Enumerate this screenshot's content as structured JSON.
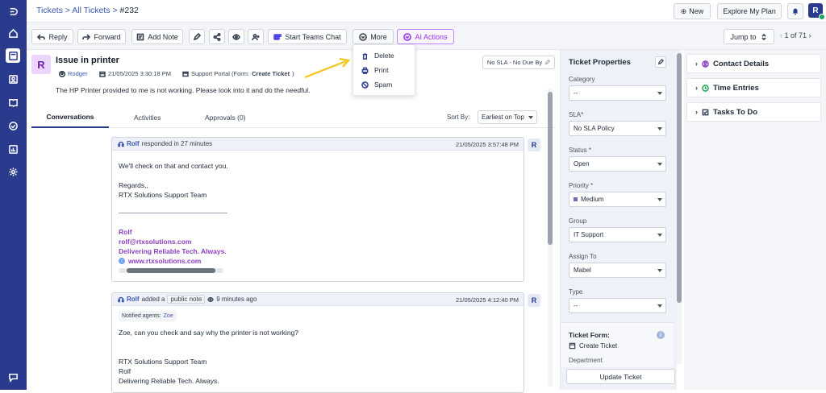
{
  "header": {
    "crumb_tickets": "Tickets",
    "sep1": ">",
    "crumb_all": "All Tickets",
    "sep2": ">",
    "ticket_no": "#232",
    "new_label": "New",
    "plan_label": "Explore My Plan",
    "avatar_initial": "R"
  },
  "toolbar": {
    "reply": "Reply",
    "forward": "Forward",
    "add_note": "Add Note",
    "teams": "Start Teams Chat",
    "more": "More",
    "ai": "AI Actions",
    "jump": "Jump to",
    "pager": "1 of 71"
  },
  "dropdown": {
    "items": [
      {
        "label": "Delete",
        "icon": "trash-icon"
      },
      {
        "label": "Print",
        "icon": "printer-icon"
      },
      {
        "label": "Spam",
        "icon": "block-icon"
      }
    ]
  },
  "ticket": {
    "initial": "R",
    "title": "Issue in printer",
    "requester": "Rodger",
    "created": "21/05/2025 3:30:18 PM",
    "source_prefix": "Support Portal (Form: ",
    "source_form": "Create Ticket",
    "source_suffix": ")",
    "description": "The HP Printer provided to me is not working. Please look into it and do the needful.",
    "sla_badge": "No SLA - No Due By"
  },
  "tabs": [
    "Conversations",
    "Activities",
    "Approvals (0)"
  ],
  "sort": {
    "label": "Sort By:",
    "value": "Earliest on Top"
  },
  "conversations": [
    {
      "author": "Rolf",
      "action": "responded in 27 minutes",
      "time": "21/05/2025 3:57:48 PM",
      "avatar": "R",
      "body": [
        "We'll check on that and contact you.",
        "Regards,,",
        "RTX Solutions Support Team"
      ],
      "signature": [
        "Rolf",
        "rolf@rtxsolutions.com",
        "Delivering Reliable Tech. Always.",
        "www.rtxsolutions.com"
      ]
    },
    {
      "author": "Rolf",
      "action": "added a",
      "note_type": "public note",
      "ago": "9 minutes ago",
      "time": "21/05/2025 4:12:40 PM",
      "avatar": "R",
      "notified_label": "Notified agents:",
      "notified_agent": "Zoe",
      "body": [
        "Zoe, can you check and say why the printer is not working?",
        "RTX Solutions Support Team",
        "Rolf",
        "Delivering Reliable Tech. Always."
      ]
    }
  ],
  "properties": {
    "title": "Ticket Properties",
    "fields": [
      {
        "label": "Category",
        "value": "--"
      },
      {
        "label": "SLA*",
        "value": "No SLA Policy"
      },
      {
        "label": "Status *",
        "value": "Open"
      },
      {
        "label": "Priority *",
        "value": "Medium"
      },
      {
        "label": "Group",
        "value": "IT Support"
      },
      {
        "label": "Assign To",
        "value": "Mabel"
      },
      {
        "label": "Type",
        "value": "--"
      }
    ],
    "form_label": "Ticket Form:",
    "form_value": "Create Ticket",
    "department_label": "Department",
    "update_button": "Update Ticket"
  },
  "side_panels": [
    "Contact Details",
    "Time Entries",
    "Tasks To Do"
  ],
  "colors": {
    "brand": "#2a3a8c",
    "accent": "#3b56b5",
    "ai": "#9333ea",
    "annotation_arrow": "#f5c518"
  }
}
